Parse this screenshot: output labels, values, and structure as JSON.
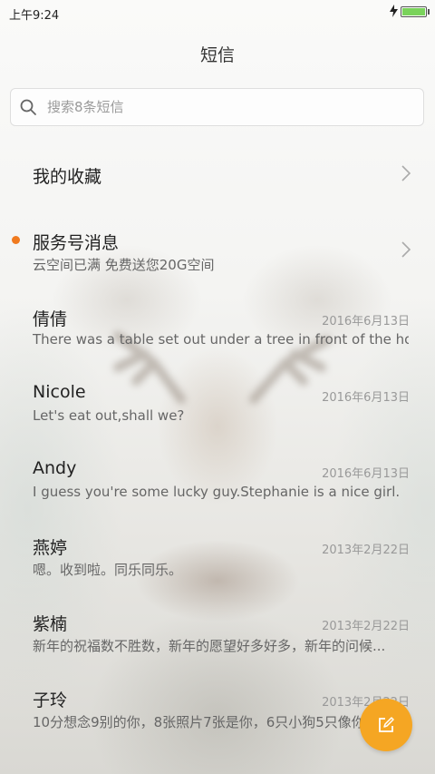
{
  "status_bar": {
    "time": "上午9:24",
    "charging_icon": "lightning-bolt-icon",
    "battery_icon": "battery-full-icon",
    "battery_color": "#7ad35b"
  },
  "header": {
    "title": "短信"
  },
  "search": {
    "placeholder": "搜索8条短信",
    "icon": "search-icon"
  },
  "favorites": {
    "label": "我的收藏",
    "icon": "chevron-right-icon"
  },
  "service": {
    "title": "服务号消息",
    "subtitle": "云空间已满 免费送您20G空间",
    "unread_dot_color": "#f07a1e",
    "icon": "chevron-right-icon"
  },
  "conversations": [
    {
      "name": "倩倩",
      "date": "2016年6月13日",
      "preview": "There was a table set out under a tree in front of the ho..."
    },
    {
      "name": "Nicole",
      "date": "2016年6月13日",
      "preview": "Let's eat out,shall we?"
    },
    {
      "name": "Andy",
      "date": "2016年6月13日",
      "preview": "I guess you're some lucky guy.Stephanie is a nice girl."
    },
    {
      "name": "燕婷",
      "date": "2013年2月22日",
      "preview": "嗯。收到啦。同乐同乐。"
    },
    {
      "name": "紫楠",
      "date": "2013年2月22日",
      "preview": "新年的祝福数不胜数，新年的愿望好多好多，新年的问候..."
    },
    {
      "name": "子玲",
      "date": "2013年2月22日",
      "preview": "10分想念9别的你，8张照片7张是你，6只小狗5只像你"
    }
  ],
  "compose_button": {
    "icon": "compose-icon",
    "color": "#f5a623"
  }
}
